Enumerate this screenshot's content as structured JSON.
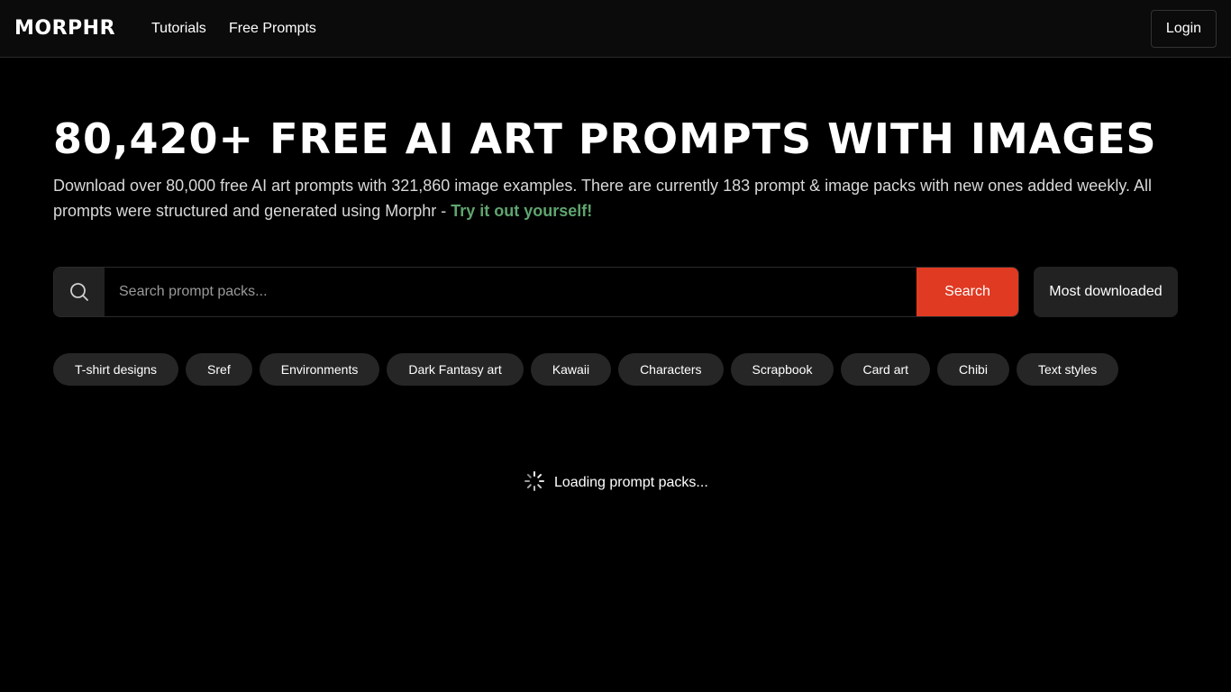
{
  "header": {
    "logo": "MORPHR",
    "nav": [
      {
        "label": "Tutorials"
      },
      {
        "label": "Free Prompts"
      }
    ],
    "login_label": "Login"
  },
  "hero": {
    "title": "80,420+ FREE AI ART PROMPTS WITH IMAGES",
    "description": "Download over 80,000 free AI art prompts with 321,860 image examples. There are currently 183 prompt & image packs with new ones added weekly. All prompts were structured and generated using Morphr - ",
    "cta": "Try it out yourself!"
  },
  "search": {
    "placeholder": "Search prompt packs...",
    "value": "",
    "button_label": "Search",
    "sort_label": "Most downloaded"
  },
  "tags": [
    {
      "label": "T-shirt designs"
    },
    {
      "label": "Sref"
    },
    {
      "label": "Environments"
    },
    {
      "label": "Dark Fantasy art"
    },
    {
      "label": "Kawaii"
    },
    {
      "label": "Characters"
    },
    {
      "label": "Scrapbook"
    },
    {
      "label": "Card art"
    },
    {
      "label": "Chibi"
    },
    {
      "label": "Text styles"
    }
  ],
  "loading": {
    "text": "Loading prompt packs...",
    "icon": "spinner-icon"
  },
  "colors": {
    "accent": "#e03a22",
    "cta": "#5fa56f",
    "background": "#000000",
    "chip": "#262626"
  }
}
